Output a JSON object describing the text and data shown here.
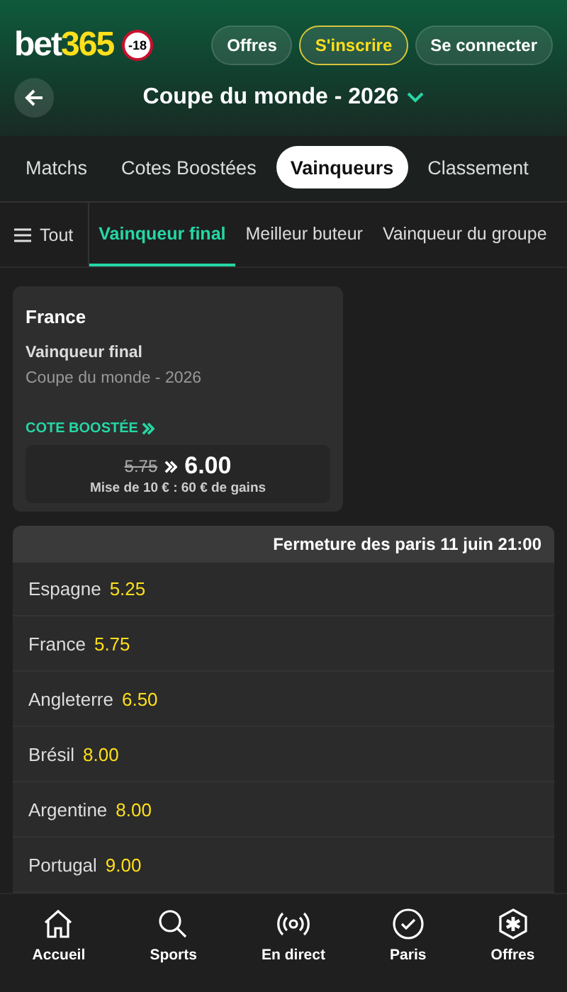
{
  "header": {
    "logo": {
      "word": "bet",
      "digits": "365"
    },
    "age_badge": "-18",
    "buttons": [
      {
        "label": "Offres",
        "kind": "plain"
      },
      {
        "label": "S'inscrire",
        "kind": "outlined"
      },
      {
        "label": "Se connecter",
        "kind": "plain"
      }
    ],
    "title": "Coupe du monde - 2026"
  },
  "tabs": [
    {
      "label": "Matchs",
      "selected": false
    },
    {
      "label": "Cotes Boostées",
      "selected": false
    },
    {
      "label": "Vainqueurs",
      "selected": true
    },
    {
      "label": "Classement",
      "selected": false
    }
  ],
  "filter": {
    "label": "Tout"
  },
  "subtabs": [
    {
      "label": "Vainqueur final",
      "selected": true
    },
    {
      "label": "Meilleur buteur",
      "selected": false
    },
    {
      "label": "Vainqueur du groupe",
      "selected": false
    }
  ],
  "boost_card": {
    "team": "France",
    "market": "Vainqueur final",
    "competition": "Coupe du monde - 2026",
    "badge": "COTE BOOSTÉE",
    "old_odds": "5.75",
    "new_odds": "6.00",
    "payout": "Mise de 10 € : 60 € de gains"
  },
  "market": {
    "closing": "Fermeture des paris 11 juin 21:00",
    "rows": [
      {
        "team": "Espagne",
        "odds": "5.25"
      },
      {
        "team": "France",
        "odds": "5.75"
      },
      {
        "team": "Angleterre",
        "odds": "6.50"
      },
      {
        "team": "Brésil",
        "odds": "8.00"
      },
      {
        "team": "Argentine",
        "odds": "8.00"
      },
      {
        "team": "Portugal",
        "odds": "9.00"
      }
    ]
  },
  "bottom_nav": [
    {
      "label": "Accueil",
      "kind": "home"
    },
    {
      "label": "Sports",
      "kind": "search"
    },
    {
      "label": "En direct",
      "kind": "live"
    },
    {
      "label": "Paris",
      "kind": "check"
    },
    {
      "label": "Offres",
      "kind": "star"
    }
  ]
}
